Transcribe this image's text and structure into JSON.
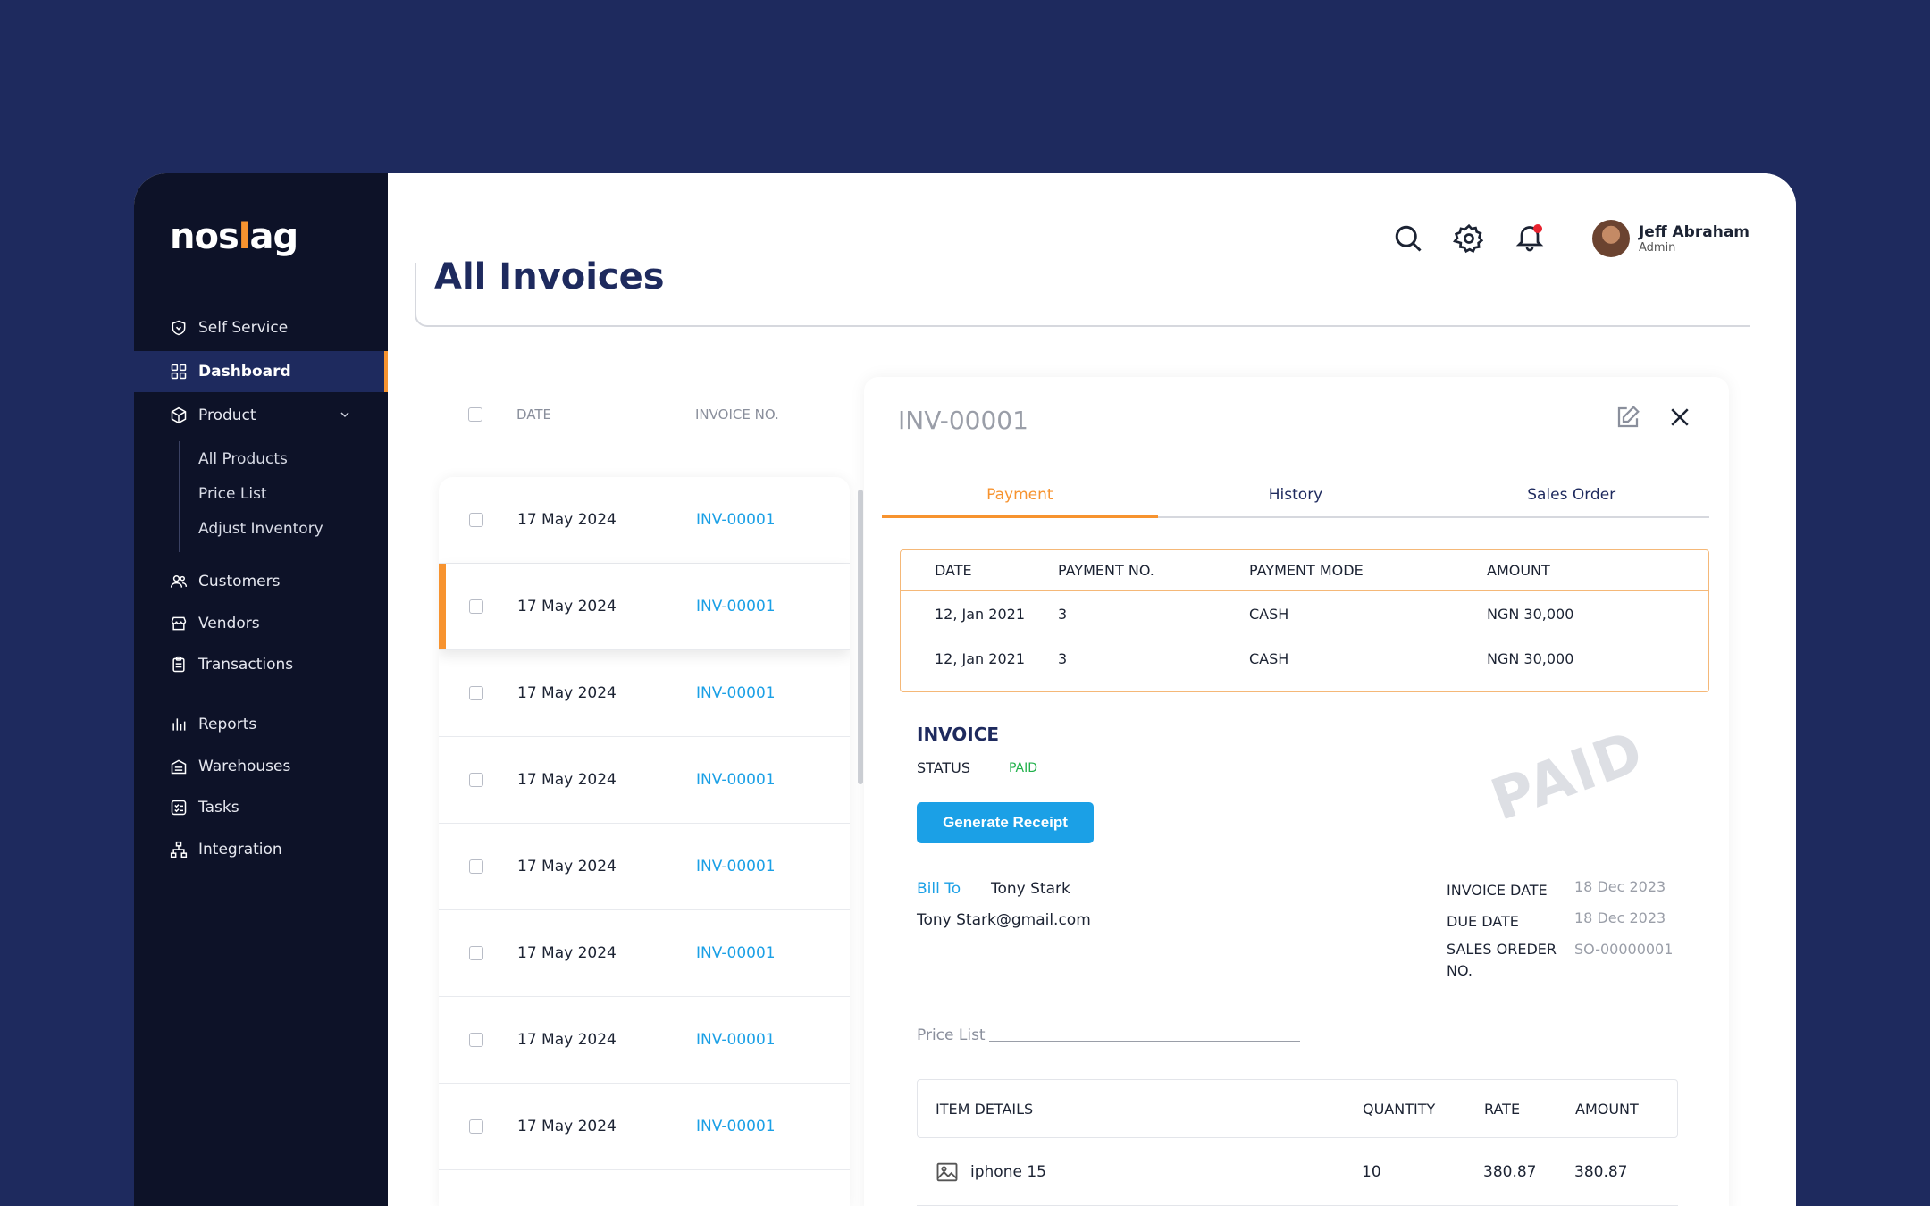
{
  "brand": {
    "logo_pre": "nos",
    "logo_mark": "l",
    "logo_post": "ag",
    "accent": "#f7932f",
    "navy": "#1e2a5e",
    "link": "#1ba0e6"
  },
  "sidebar": {
    "items": [
      {
        "label": "Self Service",
        "icon": "heart-shield-icon"
      },
      {
        "label": "Dashboard",
        "icon": "grid-icon",
        "active": true
      },
      {
        "label": "Product",
        "icon": "box-icon",
        "expanded": true
      },
      {
        "label": "Customers",
        "icon": "users-icon"
      },
      {
        "label": "Vendors",
        "icon": "store-icon"
      },
      {
        "label": "Transactions",
        "icon": "clipboard-icon"
      },
      {
        "label": "Reports",
        "icon": "bar-chart-icon"
      },
      {
        "label": "Warehouses",
        "icon": "warehouse-icon"
      },
      {
        "label": "Tasks",
        "icon": "tasks-icon"
      },
      {
        "label": "Integration",
        "icon": "network-icon"
      }
    ],
    "product_sub": [
      "All Products",
      "Price List",
      "Adjust Inventory"
    ]
  },
  "header": {
    "title": "All Invoices",
    "user_name": "Jeff Abraham",
    "user_role": "Admin"
  },
  "invoice_list": {
    "col_date": "DATE",
    "col_no": "INVOICE NO.",
    "rows": [
      {
        "date": "17 May 2024",
        "no": "INV-00001"
      },
      {
        "date": "17 May 2024",
        "no": "INV-00001",
        "selected": true
      },
      {
        "date": "17 May 2024",
        "no": "INV-00001"
      },
      {
        "date": "17 May 2024",
        "no": "INV-00001"
      },
      {
        "date": "17 May 2024",
        "no": "INV-00001"
      },
      {
        "date": "17 May 2024",
        "no": "INV-00001"
      },
      {
        "date": "17 May 2024",
        "no": "INV-00001"
      },
      {
        "date": "17 May 2024",
        "no": "INV-00001"
      }
    ]
  },
  "detail": {
    "title": "INV-00001",
    "tabs": [
      "Payment",
      "History",
      "Sales Order"
    ],
    "payments": {
      "headers": [
        "DATE",
        "PAYMENT NO.",
        "PAYMENT MODE",
        "AMOUNT"
      ],
      "rows": [
        [
          "12, Jan 2021",
          "3",
          "CASH",
          "NGN 30,000"
        ],
        [
          "12, Jan 2021",
          "3",
          "CASH",
          "NGN 30,000"
        ]
      ]
    },
    "invoice_heading": "INVOICE",
    "status_label": "STATUS",
    "status_value": "PAID",
    "watermark": "PAID",
    "generate_receipt": "Generate Receipt",
    "bill_to_label": "Bill To",
    "bill_to_name": "Tony Stark",
    "bill_to_email": "Tony Stark@gmail.com",
    "invoice_date_label": "INVOICE DATE",
    "invoice_date": "18 Dec 2023",
    "due_date_label": "DUE DATE",
    "due_date": "18 Dec 2023",
    "so_label": "SALES OREDER NO.",
    "so_value": "SO-00000001",
    "price_list_label": "Price List",
    "items": {
      "headers": [
        "ITEM DETAILS",
        "QUANTITY",
        "RATE",
        "AMOUNT"
      ],
      "rows": [
        {
          "name": "iphone 15",
          "qty": "10",
          "rate": "380.87",
          "amount": "380.87"
        }
      ]
    }
  }
}
